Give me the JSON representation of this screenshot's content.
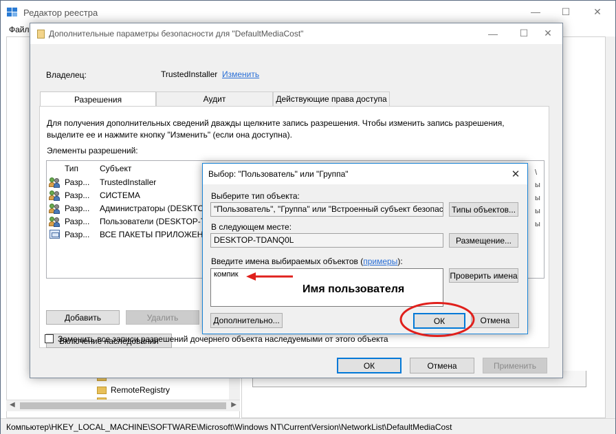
{
  "registry": {
    "title": "Редактор реестра",
    "menu_first": "Файл",
    "tree_items": [
      "RemoteRegistry"
    ],
    "status_path": "Компьютер\\HKEY_LOCAL_MACHINE\\SOFTWARE\\Microsoft\\Windows NT\\CurrentVersion\\NetworkList\\DefaultMediaCost"
  },
  "window_buttons": {
    "minimize": "—",
    "maximize": "☐",
    "close": "✕"
  },
  "advanced_dialog": {
    "title": "Дополнительные параметры безопасности  для \"DefaultMediaCost\"",
    "owner_label": "Владелец:",
    "owner_value": "TrustedInstaller",
    "owner_change": "Изменить",
    "tabs": [
      "Разрешения",
      "Аудит",
      "Действующие права доступа"
    ],
    "description": "Для получения дополнительных сведений дважды щелкните запись разрешения. Чтобы изменить запись разрешения, выделите ее и нажмите кнопку \"Изменить\" (если она доступна).",
    "permissions_label": "Элементы разрешений:",
    "columns": {
      "type": "Тип",
      "subject": "Субъект"
    },
    "rows": [
      {
        "type": "Разр...",
        "subject": "TrustedInstaller"
      },
      {
        "type": "Разр...",
        "subject": "СИСТЕМА"
      },
      {
        "type": "Разр...",
        "subject": "Администраторы (DESKTOP-"
      },
      {
        "type": "Разр...",
        "subject": "Пользователи (DESKTOP-TD"
      },
      {
        "type": "Разр...",
        "subject": "ВСЕ ПАКЕТЫ ПРИЛОЖЕНИЙ"
      }
    ],
    "right_fragments": [
      "\\",
      "ы",
      "ы",
      "ы",
      "ы"
    ],
    "add_button": "Добавить",
    "remove_button": "Удалить",
    "inherit_button": "Включение наследования",
    "replace_checkbox": "Заменить все записи разрешений дочернего объекта наследуемыми от этого объекта",
    "ok": "ОК",
    "cancel": "Отмена",
    "apply": "Применить"
  },
  "select_dialog": {
    "title": "Выбор: \"Пользователь\" или \"Группа\"",
    "object_type_label": "Выберите тип объекта:",
    "object_type_value": "\"Пользователь\", \"Группа\" или \"Встроенный субъект безопаснос",
    "object_types_button": "Типы объектов...",
    "location_label": "В следующем месте:",
    "location_value": "DESKTOP-TDANQ0L",
    "location_button": "Размещение...",
    "names_label_prefix": "Введите имена выбираемых объектов (",
    "names_label_link": "примеры",
    "names_label_suffix": "):",
    "names_value": "компик",
    "check_names_button": "Проверить имена",
    "advanced_button": "Дополнительно...",
    "ok": "ОК",
    "cancel": "Отмена"
  },
  "annotation": {
    "text": "Имя пользователя",
    "color": "#e0201c"
  }
}
